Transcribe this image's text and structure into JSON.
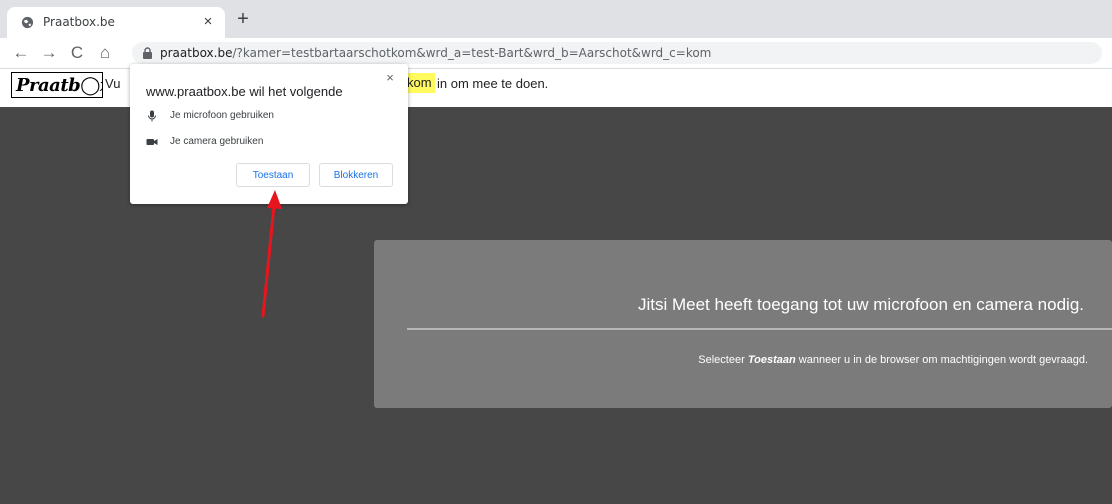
{
  "browser": {
    "tab": {
      "title": "Praatbox.be",
      "close_glyph": "×"
    },
    "new_tab_glyph": "+",
    "nav": {
      "back_glyph": "←",
      "forward_glyph": "→",
      "reload_glyph": "C",
      "home_glyph": "⌂"
    },
    "url": {
      "host": "praatbox.be",
      "path": "/?kamer=testbartaarschotkom&wrd_a=test-Bart&wrd_b=Aarschot&wrd_c=kom"
    }
  },
  "page_header": {
    "logo_text": "Praatb◯x",
    "text_before": "Vu",
    "room_highlight": "kom",
    "text_after": "in om mee te doen."
  },
  "permission_popup": {
    "title": "www.praatbox.be wil het volgende",
    "close_glyph": "×",
    "permissions": [
      {
        "label": "Je microfoon gebruiken",
        "icon": "microphone-icon"
      },
      {
        "label": "Je camera gebruiken",
        "icon": "camera-icon"
      }
    ],
    "allow_label": "Toestaan",
    "block_label": "Blokkeren"
  },
  "meet_panel": {
    "title": "Jitsi Meet heeft toegang tot uw microfoon en camera nodig.",
    "sub_before": "Selecteer",
    "sub_emphasis": "Toestaan",
    "sub_after": "wanneer u in de browser om machtigingen wordt gevraagd."
  },
  "colors": {
    "accent_blue": "#1a73e8",
    "highlight_yellow": "#fffa5e",
    "meet_background": "#474747",
    "panel_background": "#7b7b7b",
    "annotation_arrow": "#e8141e"
  }
}
